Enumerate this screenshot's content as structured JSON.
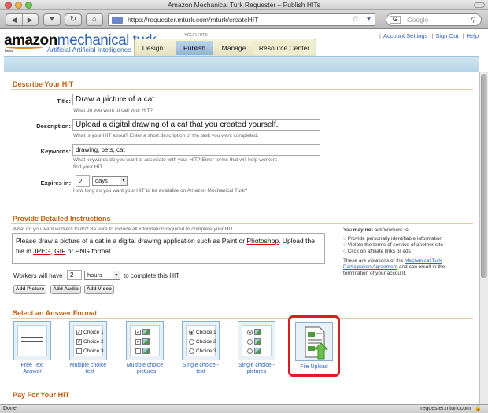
{
  "window": {
    "title": "Amazon Mechanical Turk Requester – Publish HITs"
  },
  "browser": {
    "url": "https://requester.mturk.com/mturk/createHIT",
    "search_placeholder": "Google",
    "status_left": "Done",
    "status_right": "requester.mturk.com"
  },
  "header": {
    "logo_main": "amazon",
    "logo_mt": "mechanical turk",
    "tagline": "Artificial Artificial Intelligence",
    "beta": "beta",
    "your_hits": "YOUR HITS",
    "tabs": [
      {
        "label": "Design"
      },
      {
        "label": "Publish"
      },
      {
        "label": "Manage"
      },
      {
        "label": "Resource Center"
      }
    ],
    "links": {
      "account": "Account Settings",
      "signout": "Sign Out",
      "help": "Help"
    }
  },
  "describe": {
    "heading": "Describe Your HIT",
    "title_label": "Title:",
    "title_value": "Draw a picture of a cat",
    "title_help": "What do you want to call your HIT?",
    "desc_label": "Description:",
    "desc_value": "Upload a digital drawing of a cat that you created yourself.",
    "desc_help": "What is your HIT about? Enter a short description of the task you want completed.",
    "keywords_label": "Keywords:",
    "keywords_value": "drawing, pets, cat",
    "keywords_help1": "What keywords do you want to associate with your HIT? Enter terms that will help workers",
    "keywords_help2": "find your HIT.",
    "expires_label": "Expires in:",
    "expires_value": "2",
    "expires_unit": "days",
    "expires_help": "How long do you want your HIT to be available on Amazon Mechanical Turk?"
  },
  "instructions": {
    "heading": "Provide Detailed Instructions",
    "prompt": "What do you want workers to do? Be sure to include all information required to complete your HIT.",
    "text_1": "Please draw a picture of a cat in a digital drawing application such as Paint or ",
    "text_link1": "Photoshop",
    "text_2": ". Upload the",
    "text_3": "file in ",
    "text_link2": "JPEG",
    "text_4": ", ",
    "text_link3": "GIF",
    "text_5": " or PNG format.",
    "workers_pre": "Workers will have",
    "workers_value": "2",
    "workers_unit": "hours",
    "workers_post": "to complete this HIT",
    "btn_picture": "Add Picture",
    "btn_audio": "Add Audio",
    "btn_video": "Add Video",
    "side_pre": "You ",
    "side_bold": "may not",
    "side_post": " ask Workers to:",
    "side_items": [
      "Provide personally identifiable information",
      "Violate the terms of service of another site",
      "Click on affiliate links or ads"
    ],
    "side_note1": "These are violations of the ",
    "side_link": "Mechanical Turk",
    "side_link2": "Participation Agreement",
    "side_note2": " and can result in the",
    "side_note3": "termination of your account."
  },
  "answer": {
    "heading": "Select an Answer Format",
    "choice1": "Choice 1",
    "choice2": "Choice 2",
    "choice3": "Choice 3",
    "formats": [
      {
        "l1": "Free Text",
        "l2": "Answer"
      },
      {
        "l1": "Multiple choice",
        "l2": "- text"
      },
      {
        "l1": "Multiple choice",
        "l2": "- pictures"
      },
      {
        "l1": "Single choice -",
        "l2": "text"
      },
      {
        "l1": "Single choice -",
        "l2": "pictures"
      },
      {
        "l1": "File Upload",
        "l2": ""
      }
    ],
    "highlight_color": "#d42020"
  },
  "pay": {
    "heading": "Pay For Your HIT"
  }
}
